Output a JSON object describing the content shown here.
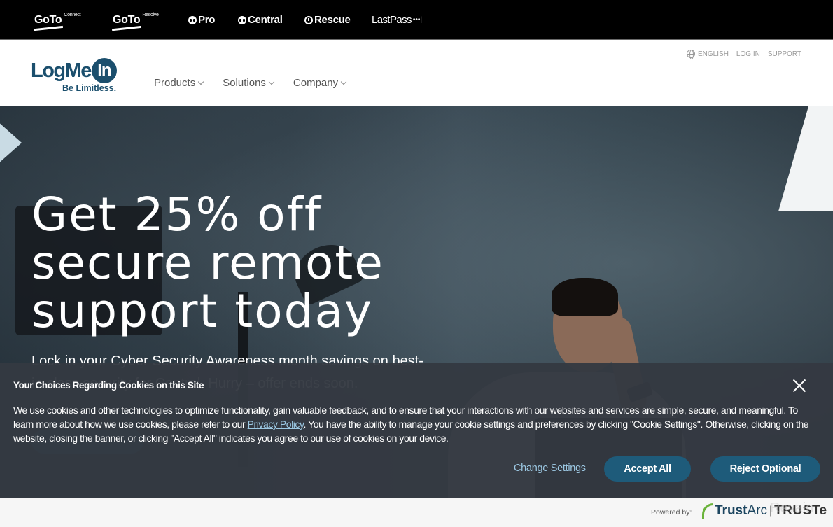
{
  "brandbar": {
    "items": [
      {
        "name": "GoTo",
        "sup": "Connect"
      },
      {
        "name": "GoTo",
        "sup": "Resolve"
      },
      {
        "name": "Pro"
      },
      {
        "name": "Central"
      },
      {
        "name": "Rescue"
      },
      {
        "name": "LastPass",
        "suffix": "•••|"
      }
    ]
  },
  "header": {
    "logo": {
      "text": "LogMe",
      "in": "In",
      "tagline": "Be Limitless."
    },
    "nav": [
      {
        "label": "Products"
      },
      {
        "label": "Solutions"
      },
      {
        "label": "Company"
      }
    ],
    "utility": {
      "language": "ENGLISH",
      "login": "LOG IN",
      "support": "SUPPORT"
    }
  },
  "hero": {
    "title": "Get 25% off secure remote support today",
    "subtitle": "Lock in your Cyber Security Awareness month savings on best-in-class security for Central. Hurry – offer ends soon."
  },
  "cookie_banner": {
    "title": "Your Choices Regarding Cookies on this Site",
    "text_before_link": "We use cookies and other technologies to optimize functionality, gain valuable feedback, and to ensure that your interactions with our websites and services are simple, secure, and meaningful. To learn more about how we use cookies, please refer to our ",
    "link_text": "Privacy Policy",
    "text_after_link": ". You have the ability to manage your cookie settings and preferences by clicking \"Cookie Settings\". Otherwise, clicking on the website, closing the banner, or clicking \"Accept All\" indicates you agree to our use of cookies on your device.",
    "change_settings": "Change Settings",
    "accept_all": "Accept All",
    "reject_optional": "Reject Optional"
  },
  "footer": {
    "powered_by": "Powered by:",
    "trustarc": "Trust",
    "trustarc_arc": "Arc",
    "separator": "|",
    "truste": "TRUSTe",
    "watermark": "Revain"
  },
  "colors": {
    "brand_blue": "#1b4f6d",
    "button_blue": "#1e5b7a",
    "link_blue": "#9cc8e3",
    "banner_bg": "#343942"
  }
}
